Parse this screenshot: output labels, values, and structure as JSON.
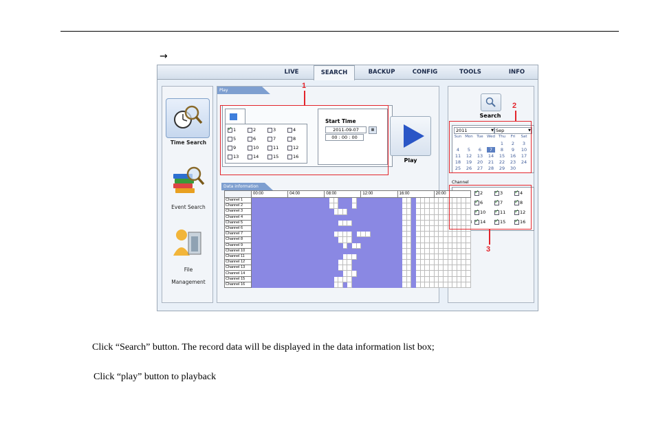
{
  "doc": {
    "arrow": "→",
    "para1": "Click “Search” button. The record data will be displayed in the data information list box;",
    "para2": "Click “play” button to playback"
  },
  "ui": {
    "tabs": [
      "LIVE",
      "SEARCH",
      "BACKUP",
      "CONFIG",
      "TOOLS",
      "INFO"
    ],
    "active_tab": "SEARCH",
    "sidebar": [
      "Time Search",
      "Event Search",
      "File",
      "Management"
    ],
    "play_panel_title": "Play",
    "start_time_label": "Start Time",
    "date_value": "2011-09-07",
    "time_value": "00 : 00 : 00",
    "play_label": "Play",
    "data_info_title": "Data information",
    "time_headers": [
      "00:00",
      "04:00",
      "08:00",
      "12:00",
      "16:00",
      "20:00"
    ],
    "search_label": "Search",
    "year": "2011",
    "month": "Sep",
    "weekdays": [
      "Sun",
      "Mon",
      "Tue",
      "Wed",
      "Thu",
      "Fri",
      "Sat"
    ],
    "calendar_rows": [
      [
        "",
        "",
        "",
        "",
        "1",
        "2",
        "3"
      ],
      [
        "4",
        "5",
        "6",
        "7",
        "8",
        "9",
        "10"
      ],
      [
        "11",
        "12",
        "13",
        "14",
        "15",
        "16",
        "17"
      ],
      [
        "18",
        "19",
        "20",
        "21",
        "22",
        "23",
        "24"
      ],
      [
        "25",
        "26",
        "27",
        "28",
        "29",
        "30",
        ""
      ]
    ],
    "selected_day": "7",
    "channel_label": "Channel",
    "channels": [
      "Channel 1",
      "Channel 2",
      "Channel 3",
      "Channel 4",
      "Channel 5",
      "Channel 6",
      "Channel 7",
      "Channel 8",
      "Channel 9",
      "Channel 10",
      "Channel 11",
      "Channel 12",
      "Channel 13",
      "Channel 14",
      "Channel 15",
      "Channel 16"
    ],
    "annotations": [
      "1",
      "2",
      "3"
    ]
  },
  "colors": {
    "record": "#8a88e3",
    "annotation": "#e3242b",
    "play": "#2a56c6"
  }
}
